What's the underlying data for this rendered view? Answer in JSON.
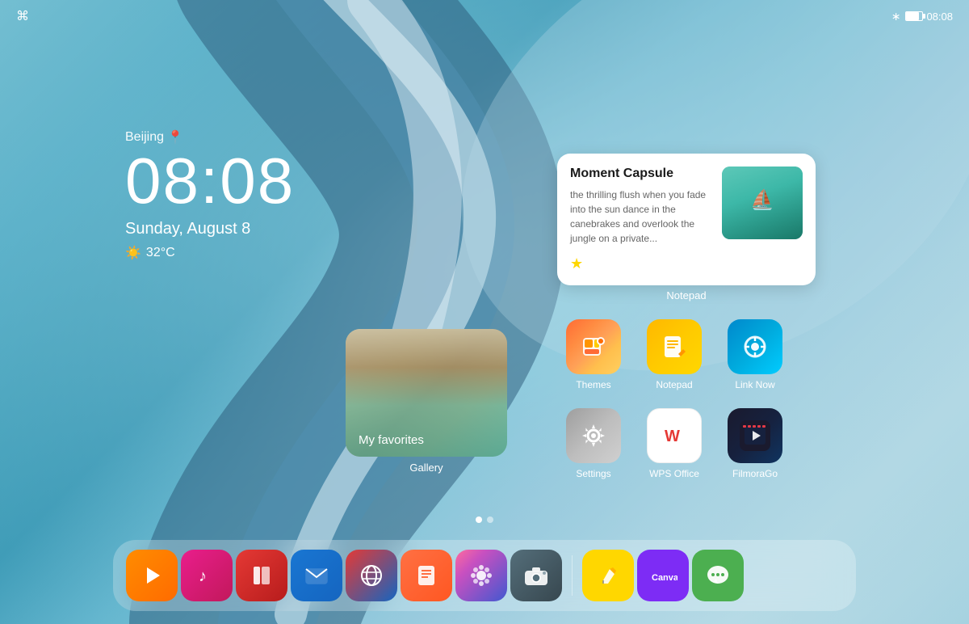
{
  "wallpaper": {
    "description": "Abstract blue teal wave ribbon wallpaper"
  },
  "status_bar": {
    "wifi_icon": "wifi",
    "bluetooth_icon": "bluetooth",
    "battery_icon": "battery",
    "time": "08:08"
  },
  "clock_widget": {
    "city": "Beijing",
    "location_icon": "pin",
    "time": "08:08",
    "date": "Sunday, August 8",
    "weather_icon": "☀️",
    "temperature": "32°C"
  },
  "moment_capsule": {
    "title": "Moment Capsule",
    "text": "the thrilling flush when you fade into the sun\ndance in the canebrakes and\noverlook the jungle on a private...",
    "star_icon": "★",
    "image_alt": "aerial ocean boat photo"
  },
  "notepad_widget_label": "Notepad",
  "apps": [
    {
      "id": "themes",
      "label": "Themes",
      "icon_type": "themes",
      "icon_char": "🖌"
    },
    {
      "id": "notepad",
      "label": "Notepad",
      "icon_type": "notepad",
      "icon_char": "📝"
    },
    {
      "id": "linknow",
      "label": "Link Now",
      "icon_type": "linknow",
      "icon_char": "💬"
    },
    {
      "id": "settings",
      "label": "Settings",
      "icon_type": "settings",
      "icon_char": "⚙"
    },
    {
      "id": "wps",
      "label": "WPS Office",
      "icon_type": "wps",
      "icon_char": "W"
    },
    {
      "id": "filmora",
      "label": "FilmoraGo",
      "icon_type": "filmora",
      "icon_char": "▶"
    }
  ],
  "gallery": {
    "folder_name": "My favorites",
    "label": "Gallery"
  },
  "page_indicators": {
    "total": 2,
    "active": 0
  },
  "dock": {
    "items": [
      {
        "id": "video",
        "label": "Video",
        "icon_type": "video-icon",
        "char": "▶"
      },
      {
        "id": "music",
        "label": "Music",
        "icon_type": "music-icon",
        "char": "♪"
      },
      {
        "id": "books",
        "label": "Books",
        "icon_type": "books-icon",
        "char": "📖"
      },
      {
        "id": "mail",
        "label": "Mail",
        "icon_type": "mail-icon",
        "char": "✉"
      },
      {
        "id": "browser",
        "label": "Browser",
        "icon_type": "browser-icon",
        "char": "🌐"
      },
      {
        "id": "memo",
        "label": "Memo",
        "icon_type": "memo-icon",
        "char": "📋"
      },
      {
        "id": "photos",
        "label": "Photos",
        "icon_type": "photos-icon",
        "char": "✦"
      },
      {
        "id": "camera",
        "label": "Camera",
        "icon_type": "camera-icon",
        "char": "📷"
      }
    ],
    "pinned_items": [
      {
        "id": "pen",
        "label": "Notes",
        "icon_type": "pen-icon",
        "char": "✒"
      },
      {
        "id": "canva",
        "label": "Canva",
        "icon_type": "canva-icon",
        "char": "Canva"
      },
      {
        "id": "messages",
        "label": "Messages",
        "icon_type": "messages-icon",
        "char": "💬"
      }
    ]
  }
}
